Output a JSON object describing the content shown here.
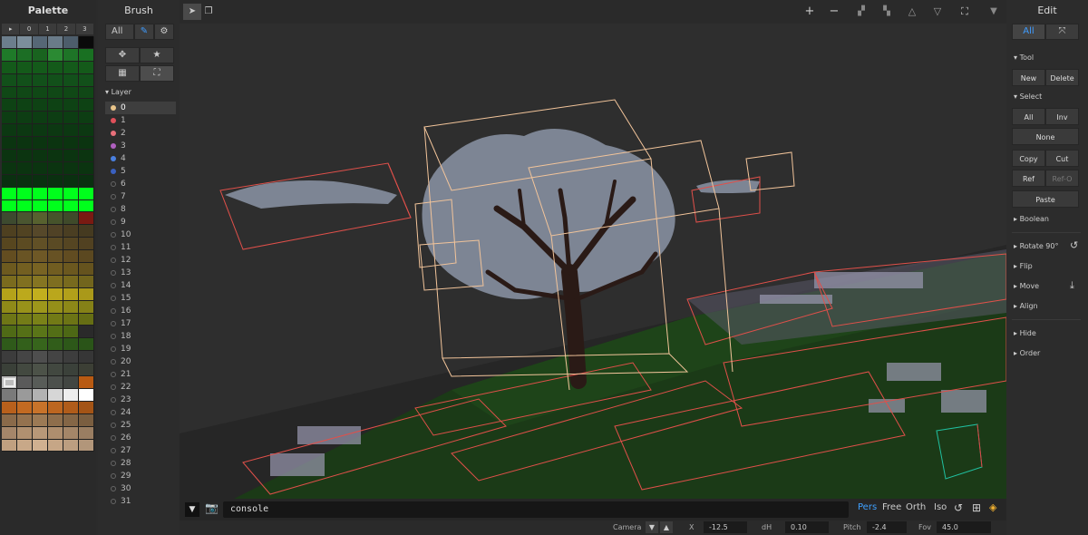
{
  "palette": {
    "title": "Palette",
    "tabs": [
      "▸",
      "0",
      "1",
      "2",
      "3"
    ],
    "colors": [
      "#6c7e8c",
      "#7c8e9b",
      "#566776",
      "#6a7b89",
      "#4d5d6b",
      "#0a0a0a",
      "#1f7a29",
      "#1c6e25",
      "#19631f",
      "#2b8a33",
      "#1e7427",
      "#197022",
      "#145a1a",
      "#145a1a",
      "#145a1a",
      "#145a1a",
      "#145a1a",
      "#145a1a",
      "#12501a",
      "#12501a",
      "#12501a",
      "#12501a",
      "#12501a",
      "#12501a",
      "#104816",
      "#104816",
      "#104816",
      "#104816",
      "#104816",
      "#104816",
      "#0e4214",
      "#0e4214",
      "#0e4214",
      "#0e4214",
      "#0e4214",
      "#0e4214",
      "#0d3d13",
      "#0d3d13",
      "#0d3d13",
      "#0d3d13",
      "#0d3d13",
      "#0d3d13",
      "#0c3812",
      "#0c3812",
      "#0c3812",
      "#0c3812",
      "#0c3812",
      "#0c3812",
      "#0b3410",
      "#0b3410",
      "#0b3410",
      "#0b3410",
      "#0b3410",
      "#0b3410",
      "#0b3410",
      "#0b3410",
      "#0b3410",
      "#0b3410",
      "#0b3410",
      "#0b3410",
      "#0b3410",
      "#0b3410",
      "#0b3410",
      "#0b3410",
      "#0b3410",
      "#0b3410",
      "#0a3010",
      "#0a3010",
      "#0a3010",
      "#0a3010",
      "#0a3010",
      "#0a3010",
      "#00ff1c",
      "#00ff1c",
      "#00ff1c",
      "#00ff1c",
      "#00ff1c",
      "#00ff1c",
      "#00ff1c",
      "#00ff1c",
      "#00ff1c",
      "#00ff1c",
      "#00ff1c",
      "#00ff1c",
      "#3d4a2f",
      "#4a5530",
      "#57612f",
      "#46532b",
      "#3f4a2a",
      "#7a1a12",
      "#4e4020",
      "#514322",
      "#56482a",
      "#504226",
      "#4a3e22",
      "#453a20",
      "#57461f",
      "#5c4b22",
      "#615026",
      "#5a4a24",
      "#554522",
      "#514121",
      "#634d20",
      "#695424",
      "#6e5826",
      "#675224",
      "#614c21",
      "#5b4820",
      "#6d5a1f",
      "#735f21",
      "#786323",
      "#715d21",
      "#6b581f",
      "#65531e",
      "#7a6b1e",
      "#807020",
      "#857522",
      "#7e6e20",
      "#786a1e",
      "#72651d",
      "#b4a21a",
      "#bca91c",
      "#c2af1e",
      "#baa71c",
      "#b2a01a",
      "#aa9919",
      "#8f8a18",
      "#98921a",
      "#9d971b",
      "#958f19",
      "#8d8818",
      "#858117",
      "#6e7616",
      "#747c17",
      "#7a8218",
      "#727a16",
      "#6c7415",
      "#666e14",
      "#4f6a16",
      "#557017",
      "#5a7518",
      "#536e16",
      "#4d6815",
      "#2a2a2a",
      "#2f5a1a",
      "#33601b",
      "#37651c",
      "#315d1a",
      "#2d5819",
      "#2a5418",
      "#3c3c3c",
      "#454545",
      "#4e4e4e",
      "#444444",
      "#3d3d3d",
      "#363636",
      "#3a4038",
      "#434940",
      "#4c5248",
      "#424840",
      "#3b413a",
      "#3c3f35",
      "#bdbdbd",
      "#5a5a5a",
      "#585c58",
      "#4c504c",
      "#424642",
      "#b85a12",
      "#7a7a7a",
      "#9a9a9a",
      "#b2b2b2",
      "#d6d6d6",
      "#eeeeee",
      "#ffffff",
      "#b8601c",
      "#c26a22",
      "#c8732a",
      "#bc6620",
      "#b05c1a",
      "#a45416",
      "#8a6a4a",
      "#94724f",
      "#9c7a55",
      "#8e6e4c",
      "#846646",
      "#7a5e40",
      "#a5866a",
      "#b09070",
      "#b89878",
      "#ae8e6e",
      "#a48668",
      "#9a7e62",
      "#c0a080",
      "#c8a888",
      "#d0b090",
      "#c6a686",
      "#bc9e80",
      "#b2967a"
    ]
  },
  "brush": {
    "title": "Brush",
    "filter_label": "All",
    "layer_header": "Layer",
    "layers": [
      {
        "label": "0",
        "color": "#e8c48a",
        "selected": true
      },
      {
        "label": "1",
        "color": "#e0505a"
      },
      {
        "label": "2",
        "color": "#e8707a"
      },
      {
        "label": "3",
        "color": "#b060c0"
      },
      {
        "label": "4",
        "color": "#4a80e0"
      },
      {
        "label": "5",
        "color": "#3a60c0"
      },
      {
        "label": "6"
      },
      {
        "label": "7"
      },
      {
        "label": "8"
      },
      {
        "label": "9"
      },
      {
        "label": "10"
      },
      {
        "label": "11"
      },
      {
        "label": "12"
      },
      {
        "label": "13"
      },
      {
        "label": "14"
      },
      {
        "label": "15"
      },
      {
        "label": "16"
      },
      {
        "label": "17"
      },
      {
        "label": "18"
      },
      {
        "label": "19"
      },
      {
        "label": "20"
      },
      {
        "label": "21"
      },
      {
        "label": "22"
      },
      {
        "label": "23"
      },
      {
        "label": "24"
      },
      {
        "label": "25"
      },
      {
        "label": "26"
      },
      {
        "label": "27"
      },
      {
        "label": "28"
      },
      {
        "label": "29"
      },
      {
        "label": "30"
      },
      {
        "label": "31"
      }
    ]
  },
  "viewport": {
    "console_text": "console",
    "projections": [
      "Pers",
      "Free",
      "Orth",
      "Iso"
    ],
    "active_projection": "Pers"
  },
  "status": {
    "camera_label": "Camera",
    "x_label": "X",
    "x_value": "-12.5",
    "dh_label": "dH",
    "dh_value": "0.10",
    "pitch_label": "Pitch",
    "pitch_value": "-2.4",
    "fov_label": "Fov",
    "fov_value": "45.0"
  },
  "edit": {
    "title": "Edit",
    "filter_label": "All",
    "tool_header": "Tool",
    "new_label": "New",
    "delete_label": "Delete",
    "select_header": "Select",
    "all_label": "All",
    "inv_label": "Inv",
    "none_label": "None",
    "copy_label": "Copy",
    "cut_label": "Cut",
    "ref_label": "Ref",
    "refo_label": "Ref-O",
    "paste_label": "Paste",
    "boolean_label": "Boolean",
    "rotate_label": "Rotate 90°",
    "flip_label": "Flip",
    "move_label": "Move",
    "align_label": "Align",
    "hide_label": "Hide",
    "order_label": "Order"
  }
}
